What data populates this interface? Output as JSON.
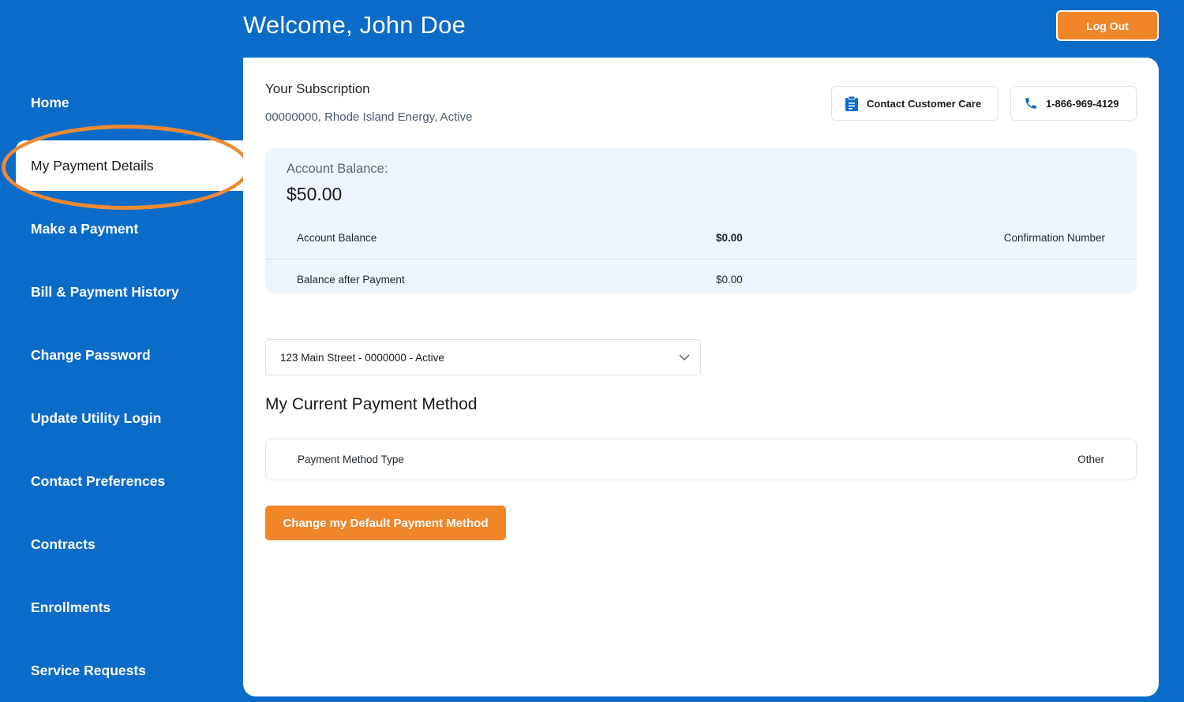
{
  "header": {
    "welcome": "Welcome, John Doe",
    "logout_label": "Log Out"
  },
  "sidebar": {
    "items": [
      {
        "label": "Home"
      },
      {
        "label": "My Payment Details",
        "active": true
      },
      {
        "label": "Make a Payment"
      },
      {
        "label": "Bill & Payment History"
      },
      {
        "label": "Change Password"
      },
      {
        "label": "Update Utility Login"
      },
      {
        "label": "Contact Preferences"
      },
      {
        "label": "Contracts"
      },
      {
        "label": "Enrollments"
      },
      {
        "label": "Service Requests"
      }
    ]
  },
  "subscription": {
    "title": "Your Subscription",
    "info": "00000000, Rhode Island Energy, Active",
    "contact_care_label": "Contact Customer Care",
    "phone_label": "1-866-969-4129"
  },
  "balance": {
    "label": "Account Balance:",
    "amount": "$50.00",
    "rows": [
      {
        "label": "Account Balance",
        "value": "$0.00",
        "extra": "Confirmation Number"
      },
      {
        "label": "Balance after Payment",
        "value": "$0.00",
        "extra": ""
      }
    ]
  },
  "account_select": {
    "value": "123 Main Street - 0000000 - Active"
  },
  "payment_method": {
    "heading": "My Current Payment Method",
    "type_label": "Payment Method Type",
    "type_value": "Other",
    "change_label": "Change my Default Payment Method"
  },
  "colors": {
    "background": "#0b6bc8",
    "accent": "#f0852a",
    "balance_panel": "#eef5fd"
  }
}
